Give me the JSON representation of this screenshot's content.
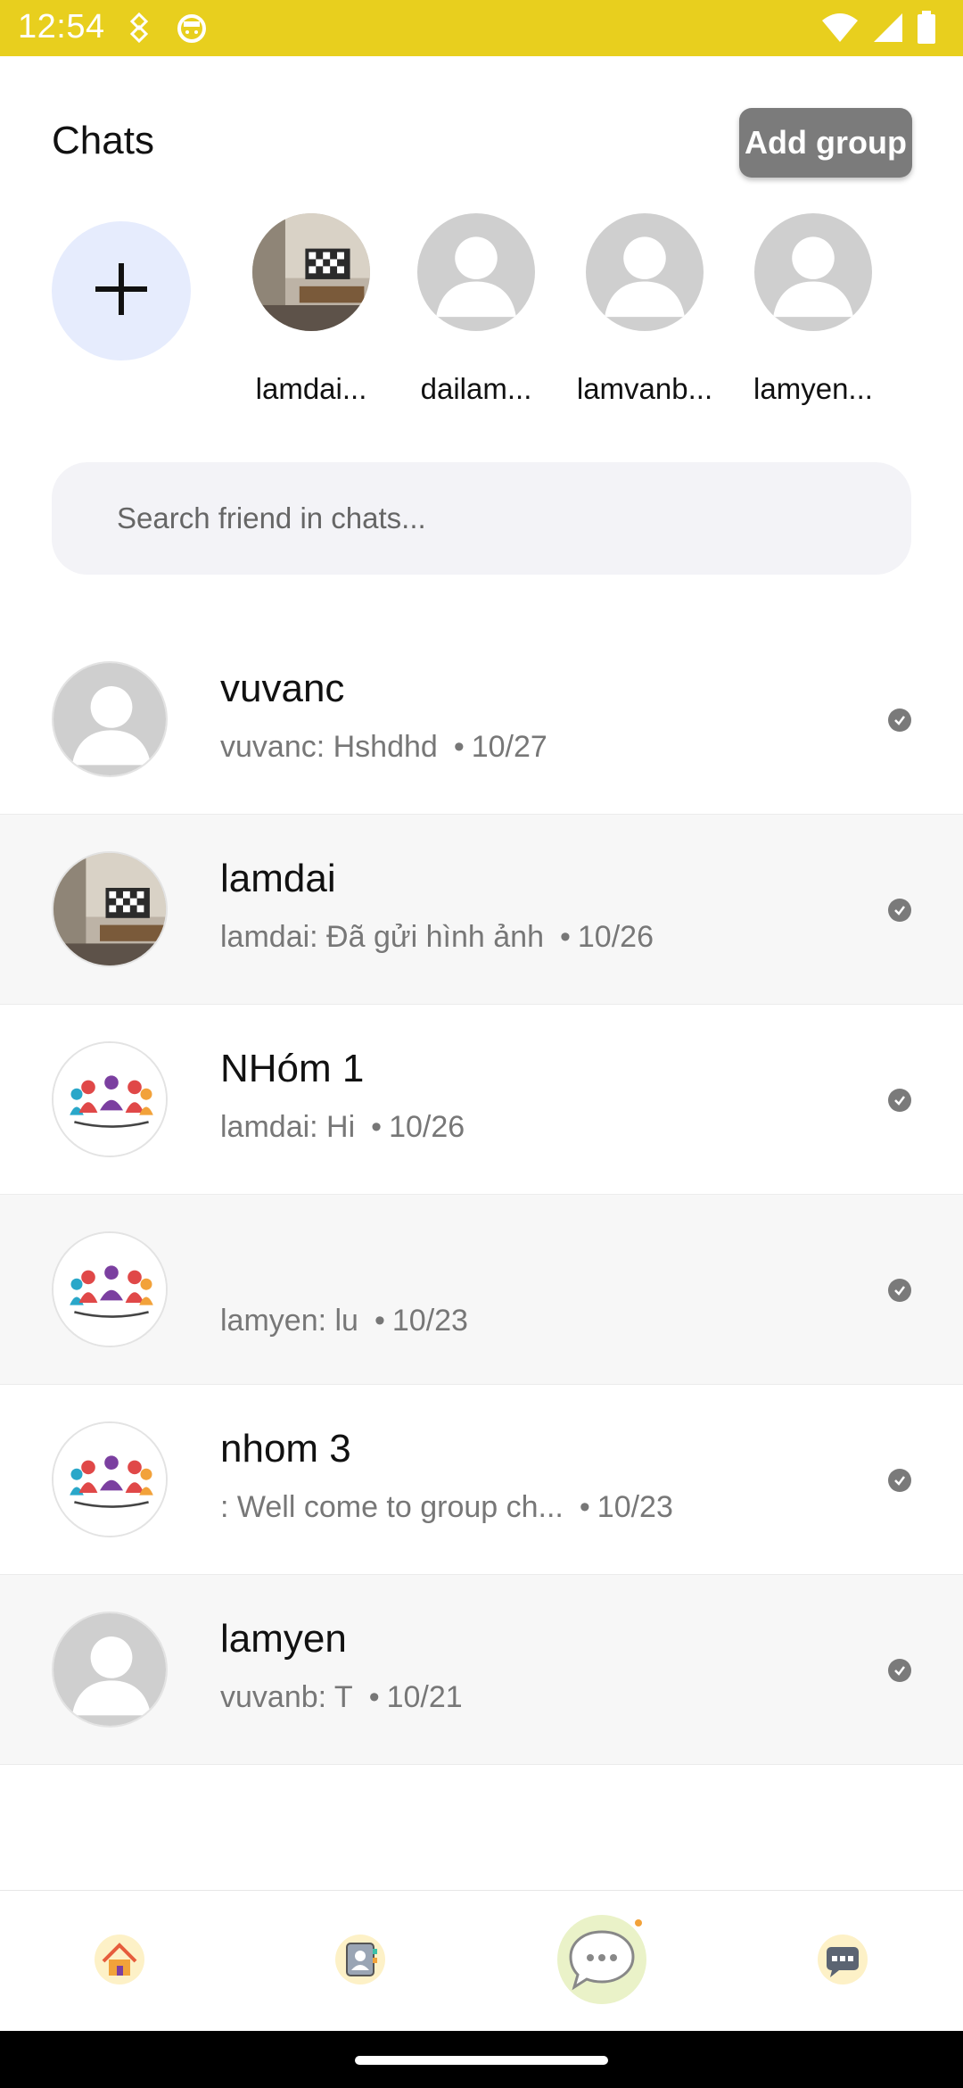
{
  "status_bar": {
    "time": "12:54",
    "icons": [
      "sync-icon",
      "app-icon",
      "wifi-icon",
      "signal-icon",
      "battery-icon"
    ],
    "color": "#e8cf1e"
  },
  "header": {
    "title": "Chats",
    "add_group_label": "Add group"
  },
  "stories": [
    {
      "name": "lamdai...",
      "avatar": "photo"
    },
    {
      "name": "dailam...",
      "avatar": "default"
    },
    {
      "name": "lamvanb...",
      "avatar": "default"
    },
    {
      "name": "lamyen...",
      "avatar": "default"
    }
  ],
  "search": {
    "placeholder": "Search friend in chats..."
  },
  "chats": [
    {
      "title": "vuvanc",
      "last_message": "vuvanc: Hshdhd",
      "date": "10/27",
      "avatar": "default"
    },
    {
      "title": "lamdai",
      "last_message": "lamdai: Đã gửi hình ảnh",
      "date": "10/26",
      "avatar": "photo"
    },
    {
      "title": "NHóm 1",
      "last_message": "lamdai: Hi",
      "date": "10/26",
      "avatar": "group"
    },
    {
      "title": "",
      "last_message": "lamyen: lu",
      "date": "10/23",
      "avatar": "group"
    },
    {
      "title": "nhom 3",
      "last_message": ": Well come to group ch...",
      "date": "10/23",
      "avatar": "group"
    },
    {
      "title": "lamyen",
      "last_message": "vuvanb: T",
      "date": "10/21",
      "avatar": "default"
    }
  ],
  "bottom_nav": [
    {
      "name": "home-icon",
      "active": false
    },
    {
      "name": "contacts-icon",
      "active": false
    },
    {
      "name": "chat-icon",
      "active": true
    },
    {
      "name": "messages-icon",
      "active": false
    }
  ],
  "colors": {
    "accent": "#e8cf1e",
    "story_add_bg": "#e6ecfd",
    "search_bg": "#f3f3f7",
    "add_group_bg": "#7b7b7b"
  }
}
